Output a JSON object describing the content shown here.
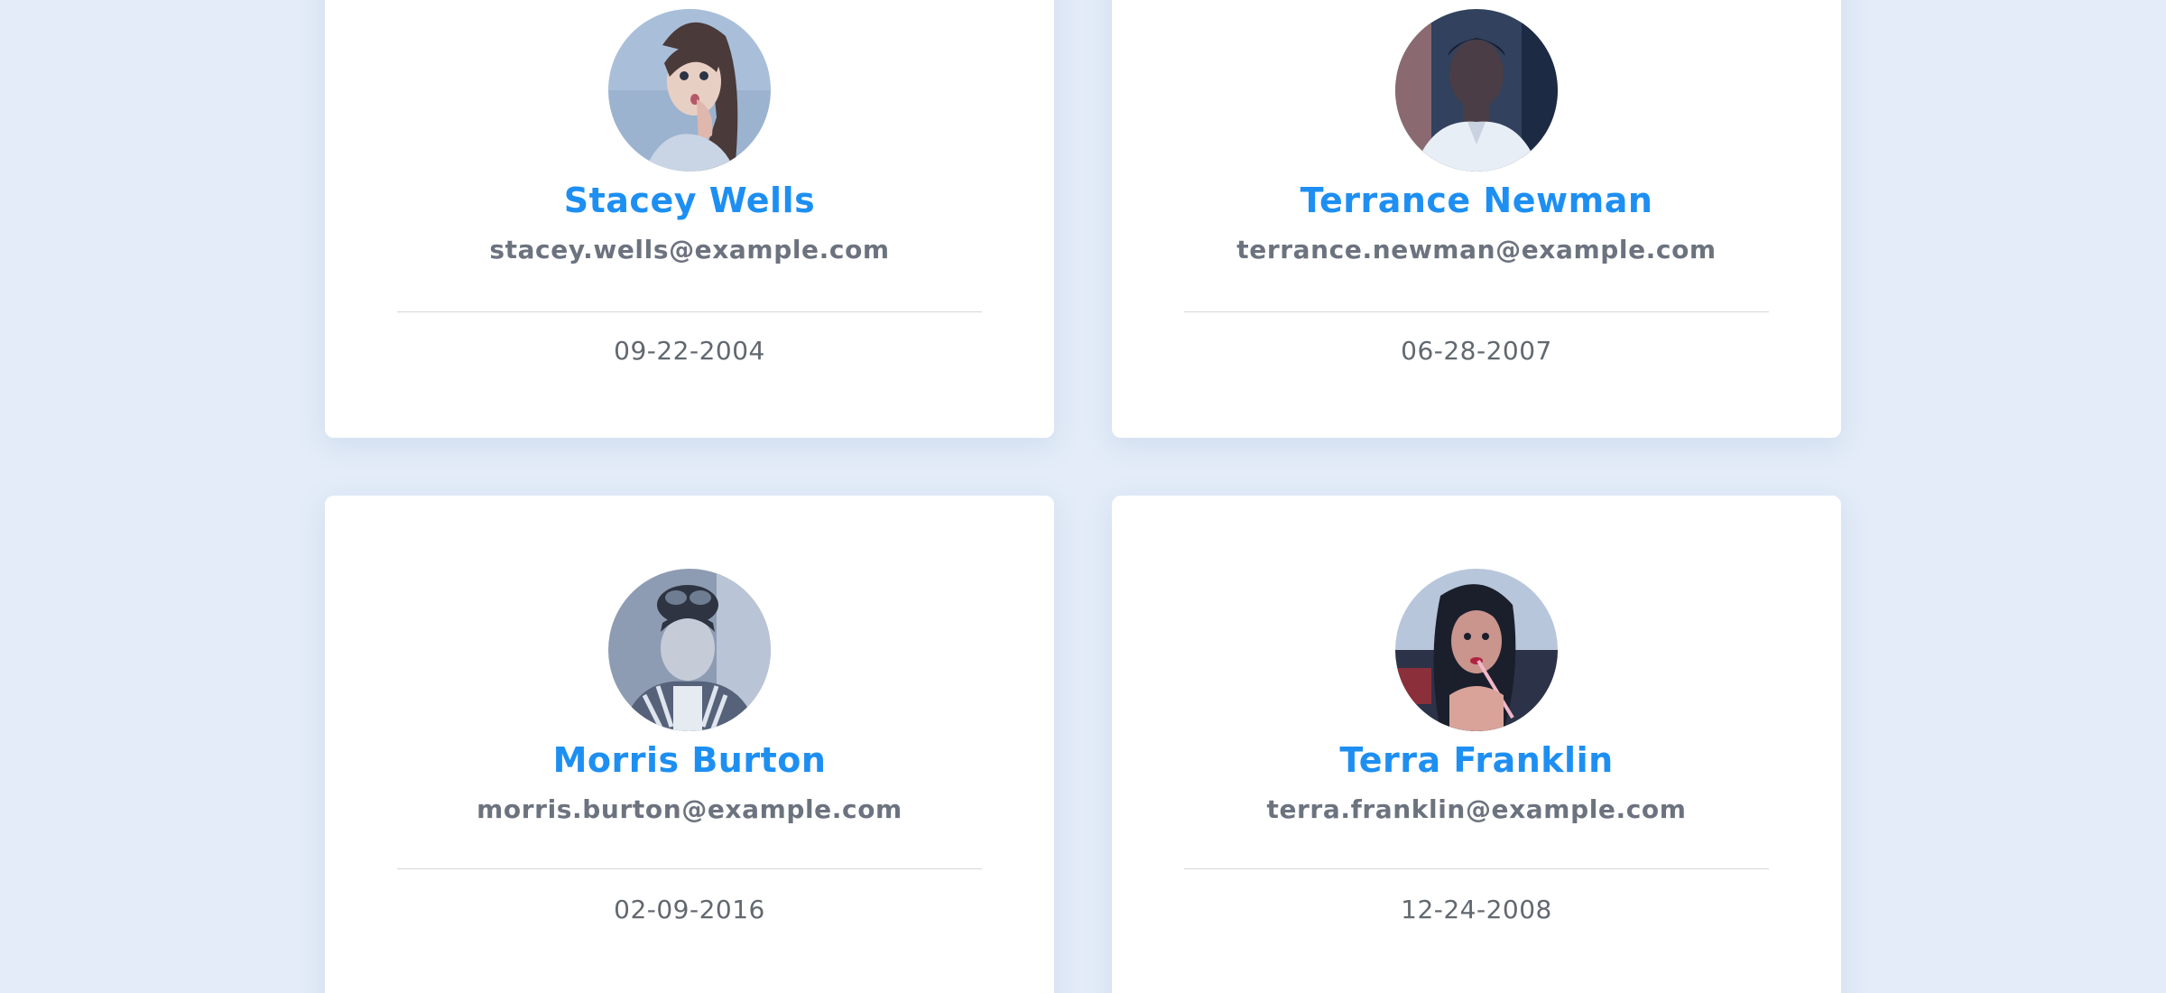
{
  "users": [
    {
      "name": "Stacey Wells",
      "email": "stacey.wells@example.com",
      "date": "09-22-2004",
      "avatar_icon": "user-photo"
    },
    {
      "name": "Terrance Newman",
      "email": "terrance.newman@example.com",
      "date": "06-28-2007",
      "avatar_icon": "user-photo"
    },
    {
      "name": "Morris Burton",
      "email": "morris.burton@example.com",
      "date": "02-09-2016",
      "avatar_icon": "user-photo"
    },
    {
      "name": "Terra Franklin",
      "email": "terra.franklin@example.com",
      "date": "12-24-2008",
      "avatar_icon": "user-photo"
    }
  ],
  "colors": {
    "background": "#e3ecf8",
    "card": "#ffffff",
    "name": "#1e8ff2",
    "email": "#6c737f",
    "date": "#62686f",
    "divider": "#d3d6db"
  }
}
